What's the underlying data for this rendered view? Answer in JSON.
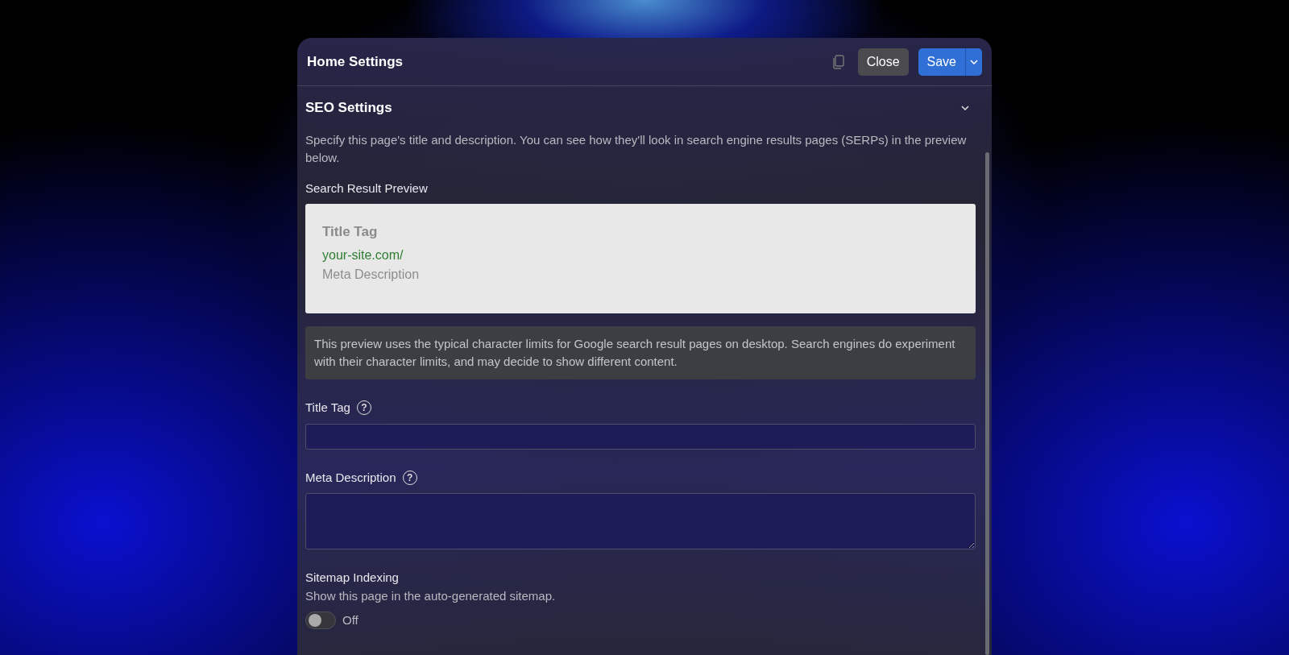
{
  "dialog": {
    "title": "Home Settings",
    "close_button": "Close",
    "save_button": "Save"
  },
  "section": {
    "title": "SEO Settings",
    "expanded": true,
    "description": "Specify this page's title and description. You can see how they'll look in search engine results pages (SERPs) in the preview below.",
    "preview_label": "Search Result Preview",
    "preview": {
      "title": "Title Tag",
      "url": "your-site.com/",
      "description": "Meta Description"
    },
    "note": "This preview uses the typical character limits for Google search result pages on desktop. Search engines do experiment with their character limits, and may decide to show different content.",
    "fields": [
      {
        "kind": "input",
        "label": "Title Tag",
        "help": "?"
      },
      {
        "kind": "textarea",
        "label": "Meta Description",
        "help": "?"
      }
    ],
    "sitemap": {
      "label": "Sitemap Indexing",
      "hint": "Show this page in the auto-generated sitemap.",
      "on": false,
      "state_label": "Off"
    }
  }
}
